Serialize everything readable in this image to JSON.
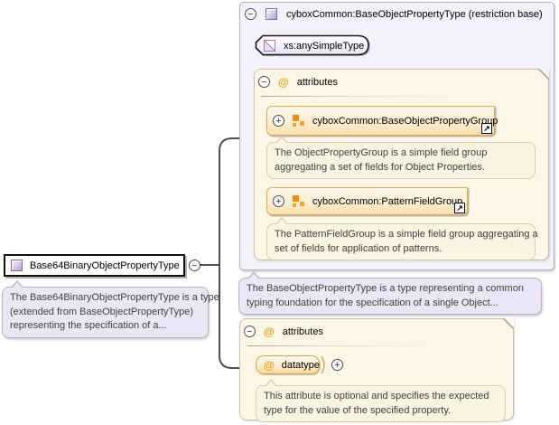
{
  "icons": {
    "collapse": "−",
    "expand": "+",
    "attribute": "@",
    "link_arrow": "↗"
  },
  "colors": {
    "panel_purple_bg": "#f3f1f9",
    "panel_purple_border": "#b3aec2",
    "panel_cream_bg": "#fcf6e7",
    "panel_cream_border": "#c6c1b4",
    "accent_orange": "#f09c0a",
    "group_box_border": "#eaa74e",
    "tooltip_purple_bg": "#eae6f5",
    "tooltip_cream_bg": "#f9f3e2",
    "connector": "#4f4f4f"
  },
  "main_type": {
    "label": "Base64BinaryObjectPropertyType",
    "annotation_lines": [
      "The Base64BinaryObjectPropertyType is a type",
      "(extended from BaseObjectPropertyType)",
      "representing the specification of a..."
    ]
  },
  "base_type": {
    "title": "cyboxCommon:BaseObjectPropertyType (restriction base)",
    "base_ref": "xs:anySimpleType",
    "attributes_label": "attributes",
    "groups": [
      {
        "label": "cyboxCommon:BaseObjectPropertyGroup",
        "annotation_lines": [
          "The ObjectPropertyGroup is a simple field group",
          "aggregating a set of fields for Object Properties."
        ]
      },
      {
        "label": "cyboxCommon:PatternFieldGroup",
        "annotation_lines": [
          "The PatternFieldGroup is a simple field group aggregating a",
          "set of fields for application of patterns."
        ]
      }
    ],
    "annotation_lines": [
      "The BaseObjectPropertyType is a type representing a common",
      "typing foundation for the specification of a single Object..."
    ]
  },
  "attributes_section": {
    "attributes_label": "attributes",
    "items": [
      {
        "name": "datatype",
        "annotation_lines": [
          "This attribute is optional and specifies the expected",
          "type for the value of the specified property."
        ]
      }
    ]
  }
}
